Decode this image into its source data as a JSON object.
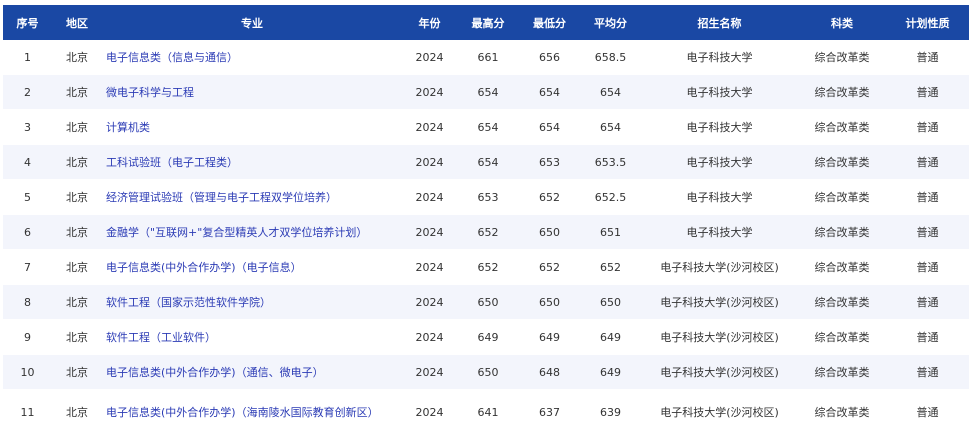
{
  "headers": [
    "序号",
    "地区",
    "专业",
    "年份",
    "最高分",
    "最低分",
    "平均分",
    "招生名称",
    "科类",
    "计划性质"
  ],
  "rows": [
    {
      "no": "1",
      "region": "北京",
      "major": "电子信息类（信息与通信）",
      "year": "2024",
      "max": "661",
      "min": "656",
      "avg": "658.5",
      "school": "电子科技大学",
      "category": "综合改革类",
      "plan": "普通"
    },
    {
      "no": "2",
      "region": "北京",
      "major": "微电子科学与工程",
      "year": "2024",
      "max": "654",
      "min": "654",
      "avg": "654",
      "school": "电子科技大学",
      "category": "综合改革类",
      "plan": "普通"
    },
    {
      "no": "3",
      "region": "北京",
      "major": "计算机类",
      "year": "2024",
      "max": "654",
      "min": "654",
      "avg": "654",
      "school": "电子科技大学",
      "category": "综合改革类",
      "plan": "普通"
    },
    {
      "no": "4",
      "region": "北京",
      "major": "工科试验班（电子工程类）",
      "year": "2024",
      "max": "654",
      "min": "653",
      "avg": "653.5",
      "school": "电子科技大学",
      "category": "综合改革类",
      "plan": "普通"
    },
    {
      "no": "5",
      "region": "北京",
      "major": "经济管理试验班（管理与电子工程双学位培养）",
      "year": "2024",
      "max": "653",
      "min": "652",
      "avg": "652.5",
      "school": "电子科技大学",
      "category": "综合改革类",
      "plan": "普通"
    },
    {
      "no": "6",
      "region": "北京",
      "major": "金融学（\"互联网+\"复合型精英人才双学位培养计划）",
      "year": "2024",
      "max": "652",
      "min": "650",
      "avg": "651",
      "school": "电子科技大学",
      "category": "综合改革类",
      "plan": "普通"
    },
    {
      "no": "7",
      "region": "北京",
      "major": "电子信息类(中外合作办学)（电子信息）",
      "year": "2024",
      "max": "652",
      "min": "652",
      "avg": "652",
      "school": "电子科技大学(沙河校区)",
      "category": "综合改革类",
      "plan": "普通"
    },
    {
      "no": "8",
      "region": "北京",
      "major": "软件工程（国家示范性软件学院）",
      "year": "2024",
      "max": "650",
      "min": "650",
      "avg": "650",
      "school": "电子科技大学(沙河校区)",
      "category": "综合改革类",
      "plan": "普通"
    },
    {
      "no": "9",
      "region": "北京",
      "major": "软件工程（工业软件）",
      "year": "2024",
      "max": "649",
      "min": "649",
      "avg": "649",
      "school": "电子科技大学(沙河校区)",
      "category": "综合改革类",
      "plan": "普通"
    },
    {
      "no": "10",
      "region": "北京",
      "major": "电子信息类(中外合作办学)（通信、微电子）",
      "year": "2024",
      "max": "650",
      "min": "648",
      "avg": "649",
      "school": "电子科技大学(沙河校区)",
      "category": "综合改革类",
      "plan": "普通"
    },
    {
      "no": "11",
      "region": "北京",
      "major": "电子信息类(中外合作办学)（海南陵水国际教育创新区）",
      "year": "2024",
      "max": "641",
      "min": "637",
      "avg": "639",
      "school": "电子科技大学(沙河校区)",
      "category": "综合改革类",
      "plan": "普通"
    }
  ]
}
